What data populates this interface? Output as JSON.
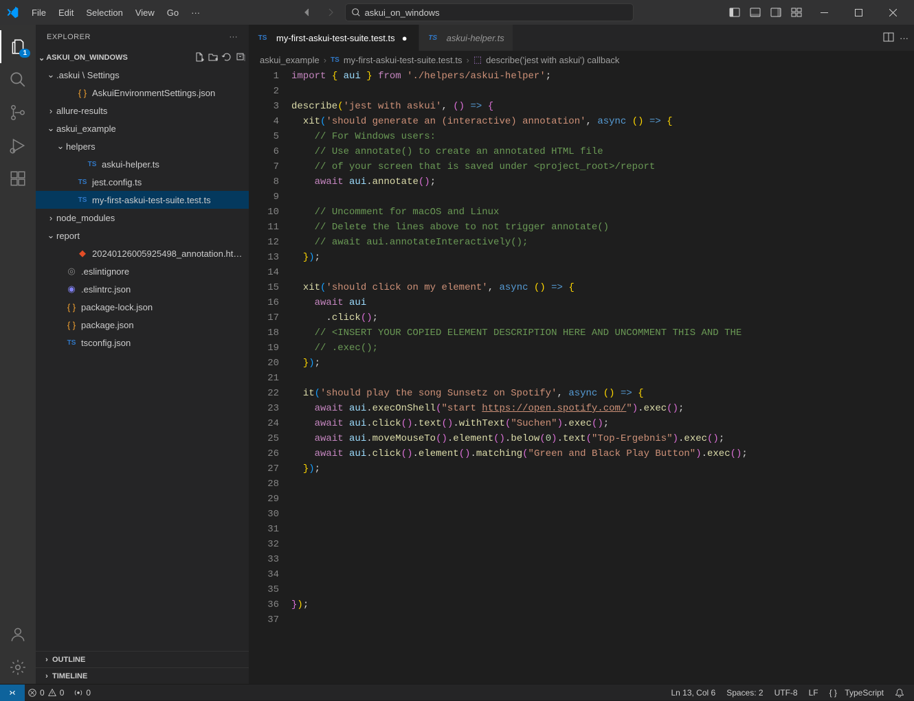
{
  "menu": [
    "File",
    "Edit",
    "Selection",
    "View",
    "Go"
  ],
  "search_label": "askui_on_windows",
  "explorer_title": "EXPLORER",
  "project_name": "ASKUI_ON_WINDOWS",
  "tree": [
    {
      "indent": 14,
      "type": "folder-open",
      "label": ".askui \\ Settings"
    },
    {
      "indent": 44,
      "type": "json",
      "label": "AskuiEnvironmentSettings.json"
    },
    {
      "indent": 14,
      "type": "folder",
      "label": "allure-results"
    },
    {
      "indent": 14,
      "type": "folder-open",
      "label": "askui_example"
    },
    {
      "indent": 28,
      "type": "folder-open",
      "label": "helpers"
    },
    {
      "indent": 58,
      "type": "ts",
      "label": "askui-helper.ts"
    },
    {
      "indent": 44,
      "type": "ts",
      "label": "jest.config.ts"
    },
    {
      "indent": 44,
      "type": "ts",
      "label": "my-first-askui-test-suite.test.ts",
      "selected": true
    },
    {
      "indent": 14,
      "type": "folder",
      "label": "node_modules"
    },
    {
      "indent": 14,
      "type": "folder-open",
      "label": "report"
    },
    {
      "indent": 44,
      "type": "html",
      "label": "20240126005925498_annotation.ht…"
    },
    {
      "indent": 28,
      "type": "ignore",
      "label": ".eslintignore"
    },
    {
      "indent": 28,
      "type": "eslint",
      "label": ".eslintrc.json"
    },
    {
      "indent": 28,
      "type": "json",
      "label": "package-lock.json"
    },
    {
      "indent": 28,
      "type": "json",
      "label": "package.json"
    },
    {
      "indent": 28,
      "type": "tsconf",
      "label": "tsconfig.json"
    }
  ],
  "outline_label": "OUTLINE",
  "timeline_label": "TIMELINE",
  "tabs": [
    {
      "label": "my-first-askui-test-suite.test.ts",
      "active": true,
      "dirty": true
    },
    {
      "label": "askui-helper.ts",
      "active": false,
      "italic": true
    }
  ],
  "breadcrumb": {
    "seg1": "askui_example",
    "seg2": "my-first-askui-test-suite.test.ts",
    "seg3": "describe('jest with askui') callback"
  },
  "line_count": 37,
  "status": {
    "errors": "0",
    "warnings": "0",
    "ports": "0",
    "cursor": "Ln 13, Col 6",
    "spaces": "Spaces: 2",
    "encoding": "UTF-8",
    "eol": "LF",
    "lang_icon": "{ }",
    "lang": "TypeScript"
  },
  "activity_badge": "1"
}
